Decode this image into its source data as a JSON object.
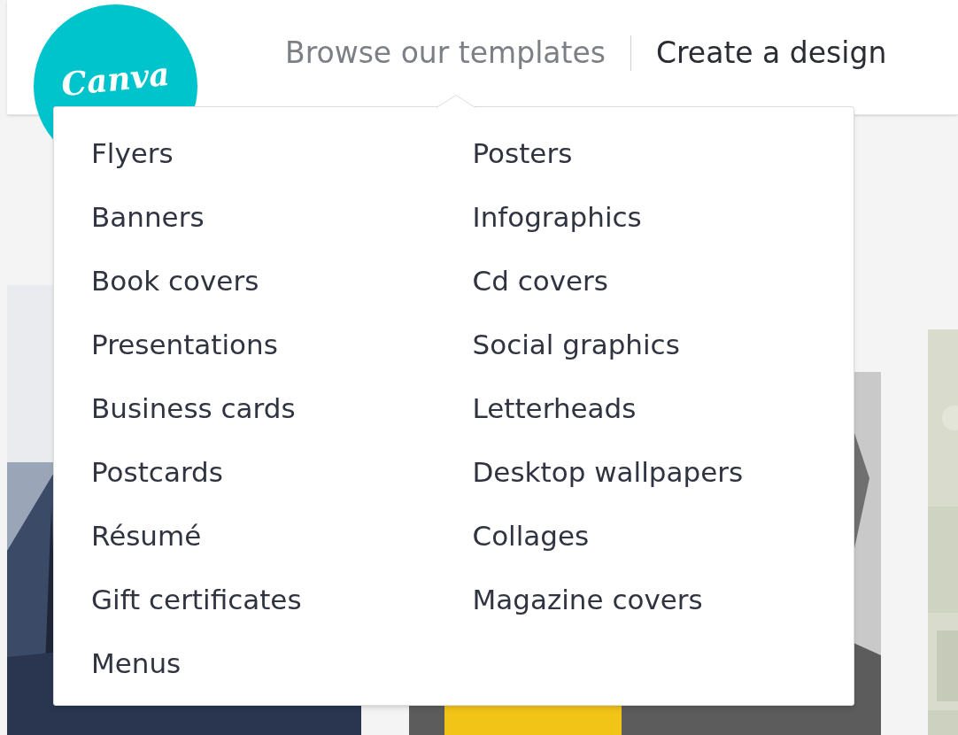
{
  "logo": {
    "text": "Canva"
  },
  "nav": [
    {
      "label": "Browse our templates",
      "selected": true
    },
    {
      "label": "Create a design",
      "selected": false
    }
  ],
  "dropdown": {
    "columns": [
      [
        "Flyers",
        "Banners",
        "Book covers",
        "Presentations",
        "Business cards",
        "Postcards",
        "Résumé",
        "Gift certificates",
        "Menus"
      ],
      [
        "Posters",
        "Infographics",
        "Cd covers",
        "Social graphics",
        "Letterheads",
        "Desktop wallpapers",
        "Collages",
        "Magazine covers"
      ]
    ]
  }
}
